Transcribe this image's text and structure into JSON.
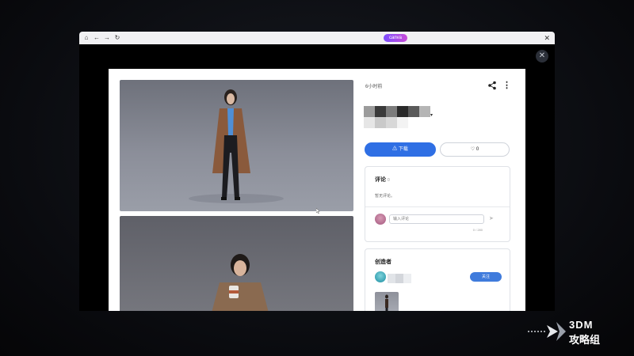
{
  "browser": {
    "app_name": "canva",
    "nav_icons": [
      "home-icon",
      "back-icon",
      "forward-icon",
      "reload-icon"
    ],
    "close_glyph": "✕"
  },
  "modal": {
    "close_glyph": "✕",
    "time_text": "6小时前",
    "more_glyph": "⋮",
    "download_label": "下载",
    "download_icon": "⚠",
    "like_count": "0",
    "comments": {
      "title": "评论",
      "count": "0",
      "empty_text": "暂无评论。",
      "input_placeholder": "输入评论",
      "char_counter": "0 / 280",
      "send_glyph": "➤"
    },
    "creator": {
      "title": "创造者",
      "follow_label": "关注"
    }
  },
  "watermark": {
    "line1": "3DM",
    "line2": "攻略组"
  },
  "colors": {
    "accent": "#2f6fe4",
    "follow": "#3f7bdc",
    "brand_gradient_start": "#7c4dff",
    "brand_gradient_end": "#c84bd8"
  }
}
